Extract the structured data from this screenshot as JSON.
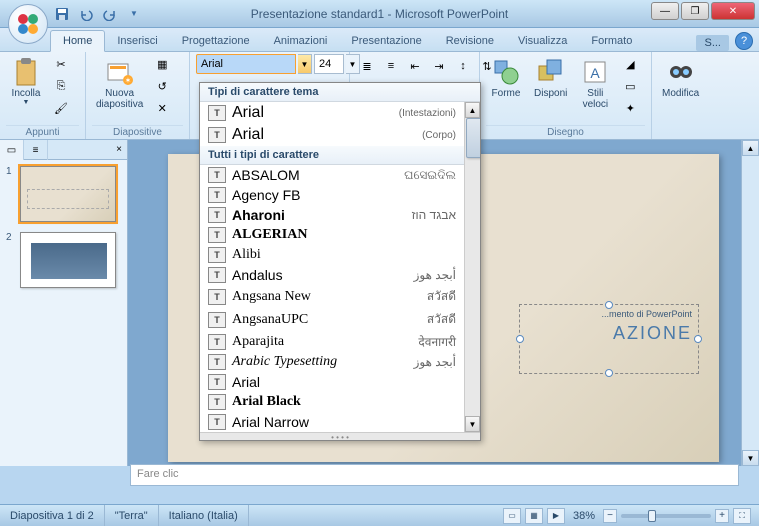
{
  "title": "Presentazione standard1 - Microsoft PowerPoint",
  "tabs_extra": "S...",
  "tabs": {
    "home": "Home",
    "inserisci": "Inserisci",
    "progettazione": "Progettazione",
    "animazioni": "Animazioni",
    "presentazione": "Presentazione",
    "revisione": "Revisione",
    "visualizza": "Visualizza",
    "formato": "Formato"
  },
  "ribbon": {
    "appunti": {
      "label": "Appunti",
      "incolla": "Incolla"
    },
    "diapositive": {
      "label": "Diapositive",
      "nuova": "Nuova\ndiapositiva"
    },
    "carattere": {
      "font_value": "Arial",
      "size_value": "24"
    },
    "disegno": {
      "label": "Disegno",
      "forme": "Forme",
      "disponi": "Disponi",
      "stili": "Stili\nveloci"
    },
    "modifica": {
      "label": "Modifica"
    }
  },
  "font_dropdown": {
    "header_theme": "Tipi di carattere tema",
    "theme_fonts": [
      {
        "name": "Arial",
        "hint": "(Intestazioni)"
      },
      {
        "name": "Arial",
        "hint": "(Corpo)"
      }
    ],
    "header_all": "Tutti i tipi di carattere",
    "all_fonts": [
      {
        "name": "ABSALOM",
        "sample": "ଘସେଇଦିଲ",
        "sample_font": "serif"
      },
      {
        "name": "Agency FB",
        "sample": "",
        "css": "font-family: 'Agency FB', sans-serif; font-stretch: condensed;"
      },
      {
        "name": "Aharoni",
        "sample": "אבגד הוז",
        "css": "font-weight: bold;"
      },
      {
        "name": "ALGERIAN",
        "sample": "",
        "css": "font-family: Algerian, serif; font-weight: bold;"
      },
      {
        "name": "Alibi",
        "sample": "",
        "css": "font-family: cursive;"
      },
      {
        "name": "Andalus",
        "sample": "أبجد هوز",
        "css": ""
      },
      {
        "name": "Angsana New",
        "sample": "สวัสดี",
        "css": "font-family: serif;"
      },
      {
        "name": "AngsanaUPC",
        "sample": "สวัสดี",
        "css": "font-family: serif;"
      },
      {
        "name": "Aparajita",
        "sample": "देवनागरी",
        "css": "font-family: serif;"
      },
      {
        "name": "Arabic Typesetting",
        "sample": "أبجد هوز",
        "css": "font-family: serif; font-style: italic;"
      },
      {
        "name": "Arial",
        "sample": "",
        "css": "font-family: Arial;"
      },
      {
        "name": "Arial Black",
        "sample": "",
        "css": "font-family: 'Arial Black'; font-weight: 900;"
      },
      {
        "name": "Arial Narrow",
        "sample": "",
        "css": "font-family: Arial; font-stretch: condensed;"
      }
    ]
  },
  "slide": {
    "subtitle_hint": "...mento di PowerPoint",
    "title_partial": "AZIONE"
  },
  "notes_placeholder": "Fare clic",
  "statusbar": {
    "slide_count": "Diapositiva 1 di 2",
    "theme": "\"Terra\"",
    "lang": "Italiano (Italia)",
    "zoom": "38%"
  }
}
